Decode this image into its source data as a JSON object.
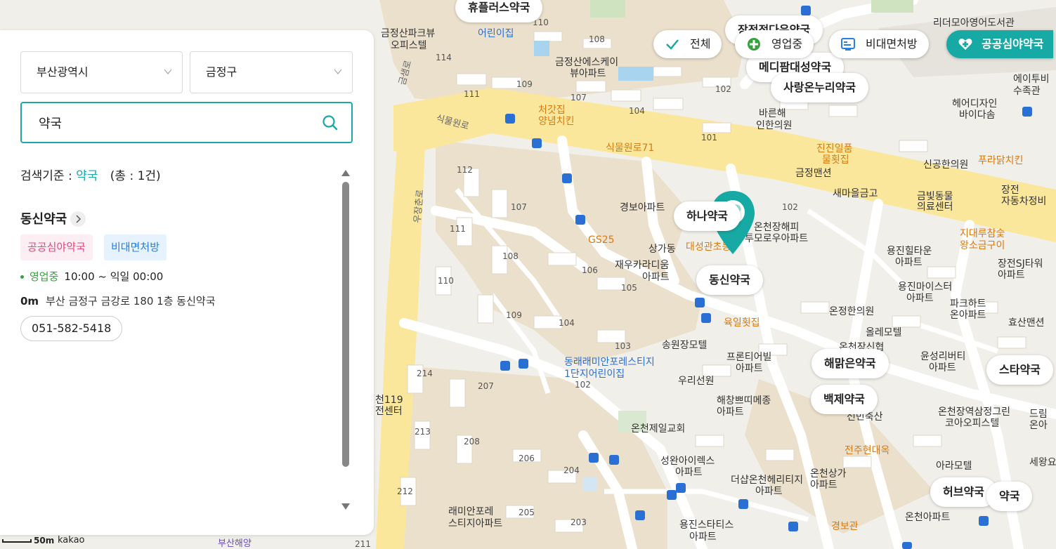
{
  "filters": [
    {
      "label": "전체",
      "icon": "check-icon"
    },
    {
      "label": "영업중",
      "icon": "open-clock-icon"
    },
    {
      "label": "비대면처방",
      "icon": "remote-prescription-icon"
    },
    {
      "label": "공공심야약국",
      "icon": "heart-pharmacy-icon"
    }
  ],
  "search": {
    "region": "부산광역시",
    "district": "금정구",
    "query": "약국"
  },
  "results": {
    "criteria_prefix": "검색기준 :",
    "keyword": "약국",
    "total": "(총 : 1건)",
    "items": [
      {
        "name": "동신약국",
        "tags": [
          "공공심야약국",
          "비대면처방"
        ],
        "status": "영업중",
        "hours": "10:00 ~ 익일 00:00",
        "distance": "0m",
        "address": "부산 금정구 금강로 180 1층 동신약국",
        "phone": "051-582-5418"
      }
    ]
  },
  "map": {
    "selected_pharmacy": "동신약국",
    "pharmacy_labels": [
      "휴플러스약국",
      "장전정다운약국",
      "메디팜대성약국",
      "사랑온누리약국",
      "하나약국",
      "동신약국",
      "해맑은약국",
      "백제약국",
      "스타약국",
      "허브약국",
      "약국"
    ],
    "place_labels": [
      "금정산파크뷰 오피스텔",
      "금정산에스케이 뷰아파트",
      "처갓집 양념치킨",
      "식물원로",
      "식물원로71",
      "바른해 인한의원",
      "경보아파트",
      "상가동",
      "대성관초등",
      "온천장해피 투모로우아파트",
      "재우카라디움 아파트",
      "육일횟집",
      "송원장모텔",
      "우리선원",
      "프론티어빌 아파트",
      "해창쁘띠메종 아파트",
      "온천제일교회",
      "동래래미안포레스티지 1단지어린이집",
      "성완아이렉스 아파트",
      "더샵온천헤리티지 아파트",
      "온천상가 아파트",
      "전주현대옥",
      "래미안포레 스티지아파트",
      "용진스타티스 아파트",
      "경보관",
      "온천아파트",
      "진진일품 물횟집",
      "금정맨션",
      "새마을금고",
      "신공한의원",
      "금빛동물 의료센터",
      "푸라닭치킨",
      "장전 자동차정비",
      "지대루참숯 왕소금구이",
      "용진힐타운 아파트",
      "장전SJ타워 아파트",
      "용진마이스터 아파트",
      "파크하트 온아파트",
      "효산맨션",
      "온정한의원",
      "올레모텔",
      "윤성리버티 아파트",
      "선민축산",
      "온천장역삼정그린 코아오피스텔",
      "아라모텔",
      "세왕요양병",
      "리더모아영어도서관",
      "에이투비 수족관",
      "헤어디자인 바이다솜",
      "드림 온아",
      "천119 전센터",
      "부산해양",
      "우장춘로",
      "금샘로",
      "GS25",
      "금정맨션",
      "온천장신협"
    ],
    "building_numbers": [
      "110",
      "114",
      "108",
      "109",
      "107",
      "111",
      "104",
      "102",
      "101",
      "112",
      "107",
      "111",
      "108",
      "110",
      "109",
      "106",
      "105",
      "104",
      "103",
      "102",
      "214",
      "207",
      "213",
      "208",
      "206",
      "204",
      "212",
      "205",
      "203",
      "211"
    ],
    "scale_text": "50m",
    "brand": "kakao"
  }
}
